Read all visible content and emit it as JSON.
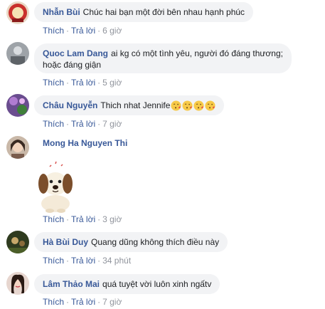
{
  "comments": [
    {
      "name": "Nhẫn Bùi",
      "text": "Chúc hai bạn một đời bên nhau hạnh phúc",
      "like": "Thích",
      "reply": "Trả lời",
      "time": "6 giờ"
    },
    {
      "name": "Quoc Lam Dang",
      "text": "ai kg có một tình yêu, người đó đáng thương;",
      "text2": "hoặc đáng giận",
      "like": "Thích",
      "reply": "Trả lời",
      "time": "5 giờ"
    },
    {
      "name": "Châu Nguyễn",
      "text": "Thich nhat Jennife",
      "emojis": [
        "kissing-face-heart-icon",
        "kissing-face-heart-icon",
        "kissing-face-heart-icon",
        "kissing-face-heart-icon"
      ],
      "like": "Thích",
      "reply": "Trả lời",
      "time": "7 giờ"
    },
    {
      "name": "Mong Ha Nguyen Thi",
      "sticker": "dog-sticker",
      "like": "Thích",
      "reply": "Trả lời",
      "time": "3 giờ"
    },
    {
      "name": "Hà Bùi Duy",
      "text": "Quang dũng không thích điều này",
      "like": "Thích",
      "reply": "Trả lời",
      "time": "34 phút"
    },
    {
      "name": "Lâm Thảo Mai",
      "text": "quá tuyệt vời luôn xinh ngấtv",
      "like": "Thích",
      "reply": "Trả lời",
      "time": "7 giờ"
    }
  ],
  "separator": "·",
  "colors": {
    "name": "#385898",
    "bubble": "#f2f3f5",
    "meta": "#90949c"
  }
}
